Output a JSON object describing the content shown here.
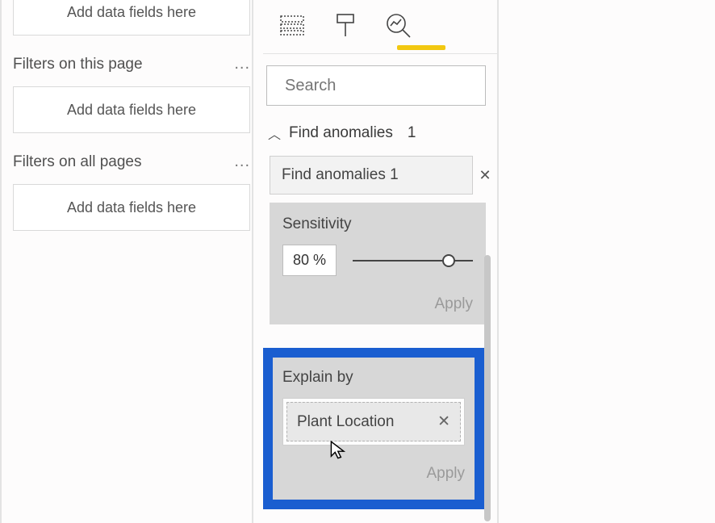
{
  "filters": {
    "well_text": "Add data fields here",
    "page_header": "Filters on this page",
    "all_header": "Filters on all pages"
  },
  "search": {
    "placeholder": "Search"
  },
  "anomalies": {
    "section_label": "Find anomalies",
    "section_count": "1",
    "card_label": "Find anomalies 1",
    "sensitivity_label": "Sensitivity",
    "sensitivity_value": "80  %",
    "apply_label": "Apply"
  },
  "explain": {
    "label": "Explain by",
    "field": "Plant Location",
    "apply_label": "Apply"
  },
  "slider_pct": 80
}
